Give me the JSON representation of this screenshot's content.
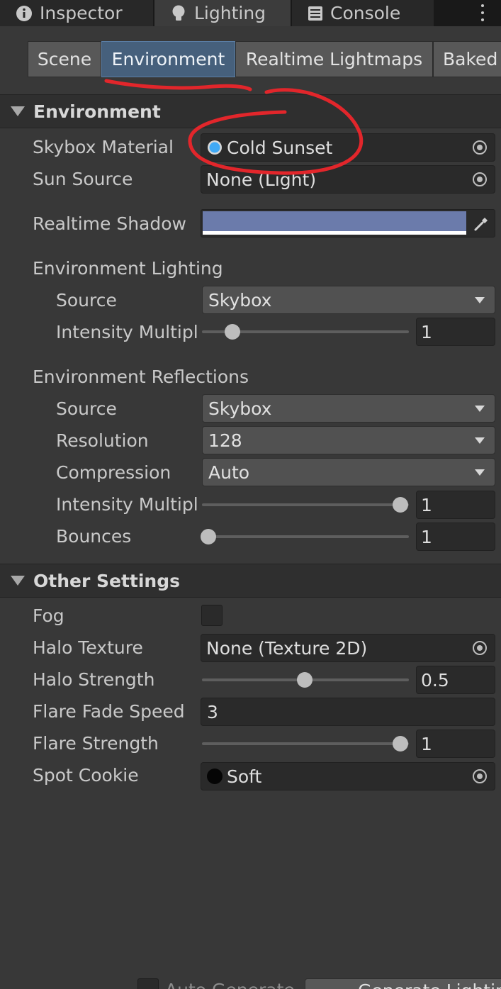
{
  "window_tabs": [
    {
      "label": "Inspector",
      "icon": "info-icon"
    },
    {
      "label": "Lighting",
      "icon": "lightbulb-icon"
    },
    {
      "label": "Console",
      "icon": "console-icon"
    }
  ],
  "sub_tabs": [
    "Scene",
    "Environment",
    "Realtime Lightmaps",
    "Baked"
  ],
  "active_sub_tab": "Environment",
  "environment": {
    "header": "Environment",
    "skybox_material": {
      "label": "Skybox Material",
      "value": "Cold Sunset"
    },
    "sun_source": {
      "label": "Sun Source",
      "value": "None (Light)"
    },
    "realtime_shadow": {
      "label": "Realtime Shadow Color",
      "color": "#6b7bab"
    },
    "environment_lighting": {
      "label": "Environment Lighting",
      "source": {
        "label": "Source",
        "value": "Skybox"
      },
      "intensity": {
        "label": "Intensity Multiplier",
        "value": "1",
        "fraction": 0.15
      }
    },
    "environment_reflections": {
      "label": "Environment Reflections",
      "source": {
        "label": "Source",
        "value": "Skybox"
      },
      "resolution": {
        "label": "Resolution",
        "value": "128"
      },
      "compression": {
        "label": "Compression",
        "value": "Auto"
      },
      "intensity": {
        "label": "Intensity Multiplier",
        "value": "1",
        "fraction": 1.0
      },
      "bounces": {
        "label": "Bounces",
        "value": "1",
        "fraction": 0.0
      }
    }
  },
  "other_settings": {
    "header": "Other Settings",
    "fog": {
      "label": "Fog",
      "checked": false
    },
    "halo_texture": {
      "label": "Halo Texture",
      "value": "None (Texture 2D)"
    },
    "halo_strength": {
      "label": "Halo Strength",
      "value": "0.5",
      "fraction": 0.5
    },
    "flare_fade_speed": {
      "label": "Flare Fade Speed",
      "value": "3"
    },
    "flare_strength": {
      "label": "Flare Strength",
      "value": "1",
      "fraction": 1.0
    },
    "spot_cookie": {
      "label": "Spot Cookie",
      "value": "Soft"
    }
  },
  "footer": {
    "auto_generate": "Auto Generate",
    "generate_button": "Generate Lighting"
  },
  "colors": {
    "accent_tab": "#46607c",
    "annotation": "#e2262b",
    "panel_bg": "#383838"
  }
}
